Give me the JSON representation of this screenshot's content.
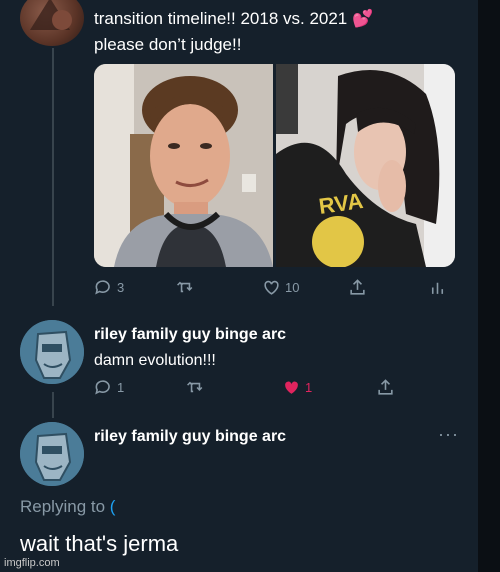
{
  "tweet": {
    "line1": "transition timeline!! 2018 vs. 2021 💕",
    "line2": "please don’t judge!!",
    "actions": {
      "replies": "3",
      "likes": "10"
    }
  },
  "reply1": {
    "name": "riley family guy binge arc",
    "body": "damn evolution!!!",
    "actions": {
      "replies": "1",
      "likes": "1"
    },
    "like_color": "#e0245e"
  },
  "reply2": {
    "name": "riley family guy binge arc",
    "more_label": "···"
  },
  "compose": {
    "replying_to_label": "Replying to",
    "replying_handle": "(",
    "text": "wait that's jerma"
  },
  "watermark": "imgflip.com",
  "colors": {
    "background": "#15202b",
    "secondary_text": "#8899a6",
    "accent": "#1da1f2"
  }
}
